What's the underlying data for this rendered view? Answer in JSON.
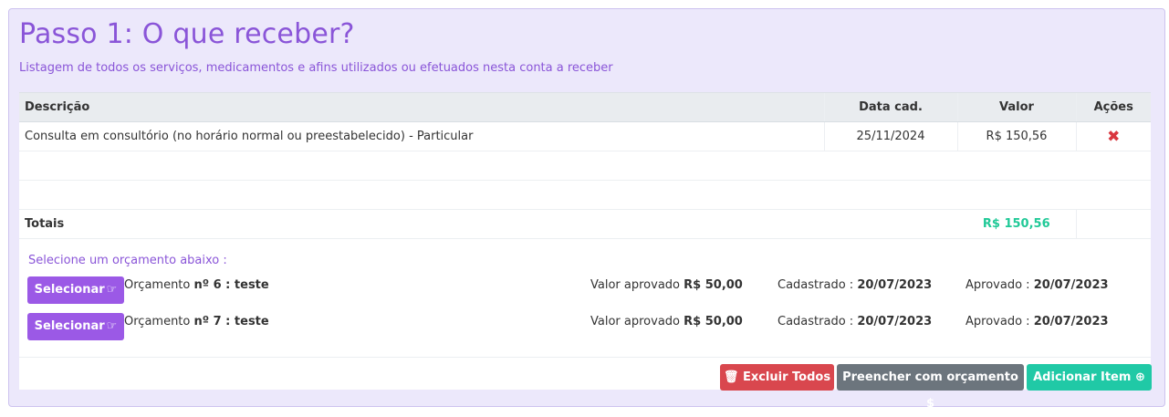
{
  "header": {
    "title": "Passo 1: O que receber?",
    "subtitle": "Listagem de todos os serviços, medicamentos e afins utilizados ou efetuados nesta conta a receber"
  },
  "table": {
    "columns": [
      "Descrição",
      "Data cad.",
      "Valor",
      "Ações"
    ],
    "rows": [
      {
        "descricao": "Consulta em consultório (no horário normal ou preestabelecido) - Particular",
        "data": "25/11/2024",
        "valor": "R$ 150,56",
        "acao_icon": "✖"
      }
    ],
    "totals": {
      "label": "Totais",
      "value": "R$ 150,56"
    }
  },
  "orcamentos": {
    "prompt": "Selecione um orçamento abaixo :",
    "select_label": "Selecionar",
    "select_icon": "☞",
    "items": [
      {
        "prefix": "Orçamento",
        "numero": "nº 6 : teste",
        "valor_label": "Valor aprovado",
        "valor": "R$ 50,00",
        "cadastrado_label": "Cadastrado :",
        "cadastrado": "20/07/2023",
        "aprovado_label": "Aprovado :",
        "aprovado": "20/07/2023"
      },
      {
        "prefix": "Orçamento",
        "numero": "nº 7 : teste",
        "valor_label": "Valor aprovado",
        "valor": "R$ 50,00",
        "cadastrado_label": "Cadastrado :",
        "cadastrado": "20/07/2023",
        "aprovado_label": "Aprovado :",
        "aprovado": "20/07/2023"
      }
    ]
  },
  "actions": {
    "delete_all": "Excluir Todos",
    "delete_icon": "🗑",
    "fill_from_budget": "Preencher com orçamento $",
    "add_item": "Adicionar Item",
    "add_icon": "⊕"
  },
  "colors": {
    "accent": "#8a55d8",
    "select_button": "#9b59e6",
    "total": "#20c997",
    "danger": "#d9474e",
    "secondary": "#6c757d",
    "success": "#20c9a6"
  }
}
